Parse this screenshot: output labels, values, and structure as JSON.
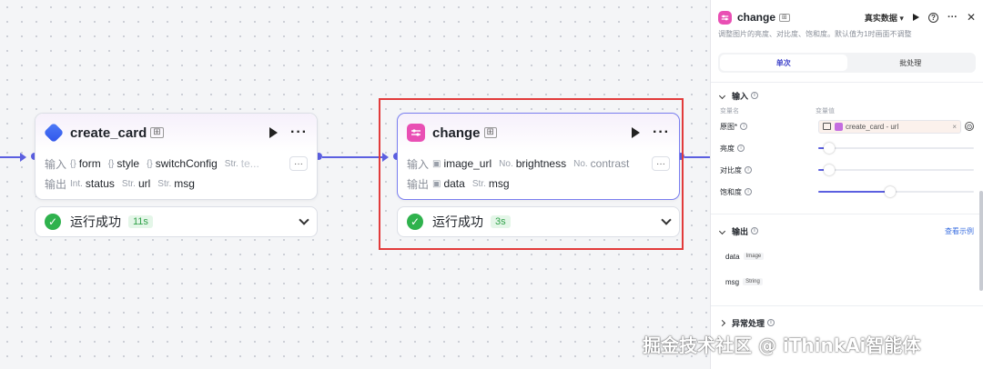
{
  "node1": {
    "title": "create_card",
    "input_label": "输入",
    "output_label": "输出",
    "inputs": [
      {
        "type": "{}",
        "name": "form"
      },
      {
        "type": "{}",
        "name": "style"
      },
      {
        "type": "{}",
        "name": "switchConfig"
      },
      {
        "type": "Str.",
        "name": "te..."
      }
    ],
    "outputs": [
      {
        "type": "Int.",
        "name": "status"
      },
      {
        "type": "Str.",
        "name": "url"
      },
      {
        "type": "Str.",
        "name": "msg"
      }
    ],
    "status_text": "运行成功",
    "time": "11s"
  },
  "node2": {
    "title": "change",
    "input_label": "输入",
    "output_label": "输出",
    "inputs": [
      {
        "type": "img",
        "name": "image_url"
      },
      {
        "type": "No.",
        "name": "brightness"
      },
      {
        "type": "No.",
        "name": "contrast"
      }
    ],
    "outputs": [
      {
        "type": "img",
        "name": "data"
      },
      {
        "type": "Str.",
        "name": "msg"
      }
    ],
    "status_text": "运行成功",
    "time": "3s"
  },
  "panel": {
    "title": "change",
    "data_mode": "真实数据",
    "description": "调整图片的亮度、对比度、饱和度。默认值为1时画面不调整",
    "tabs": [
      "单次",
      "批处理"
    ],
    "input_section": "输入",
    "col_name": "变量名",
    "col_value": "变量值",
    "params": [
      {
        "label": "原图*",
        "ref_node": "create_card",
        "ref_field": "url"
      },
      {
        "label": "亮度",
        "level": 0.07
      },
      {
        "label": "对比度",
        "level": 0.07
      },
      {
        "label": "饱和度",
        "level": 0.46
      }
    ],
    "output_section": "输出",
    "view_example": "查看示例",
    "outputs": [
      {
        "name": "data",
        "type": "Image"
      },
      {
        "name": "msg",
        "type": "String"
      }
    ],
    "exception_section": "异常处理"
  },
  "watermark": "掘金技术社区 @ iThinkAi智能体",
  "colors": {
    "accent": "#5b5fe0",
    "success": "#2fb24d",
    "highlight": "#e23b3b"
  }
}
